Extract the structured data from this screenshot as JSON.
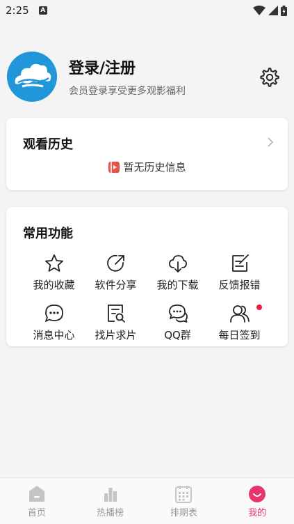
{
  "status_bar": {
    "time": "2:25",
    "notification_glyph": "A"
  },
  "profile": {
    "title": "登录/注册",
    "subtitle": "会员登录享受更多观影福利"
  },
  "history": {
    "title": "观看历史",
    "empty_text": "暂无历史信息"
  },
  "functions": {
    "title": "常用功能",
    "items": [
      {
        "label": "我的收藏",
        "icon": "star-icon"
      },
      {
        "label": "软件分享",
        "icon": "share-icon"
      },
      {
        "label": "我的下载",
        "icon": "cloud-download-icon"
      },
      {
        "label": "反馈报错",
        "icon": "edit-note-icon"
      },
      {
        "label": "消息中心",
        "icon": "message-icon"
      },
      {
        "label": "找片求片",
        "icon": "search-document-icon"
      },
      {
        "label": "QQ群",
        "icon": "chat-group-icon"
      },
      {
        "label": "每日签到",
        "icon": "users-icon",
        "badge": true
      }
    ]
  },
  "nav": {
    "items": [
      {
        "label": "首页",
        "icon": "home-icon"
      },
      {
        "label": "热播榜",
        "icon": "bar-chart-icon"
      },
      {
        "label": "排期表",
        "icon": "calendar-icon"
      },
      {
        "label": "我的",
        "icon": "smile-icon",
        "active": true
      }
    ]
  },
  "colors": {
    "accent": "#e8356b",
    "avatar_bg": "#2196d9",
    "badge": "#e8213f"
  }
}
